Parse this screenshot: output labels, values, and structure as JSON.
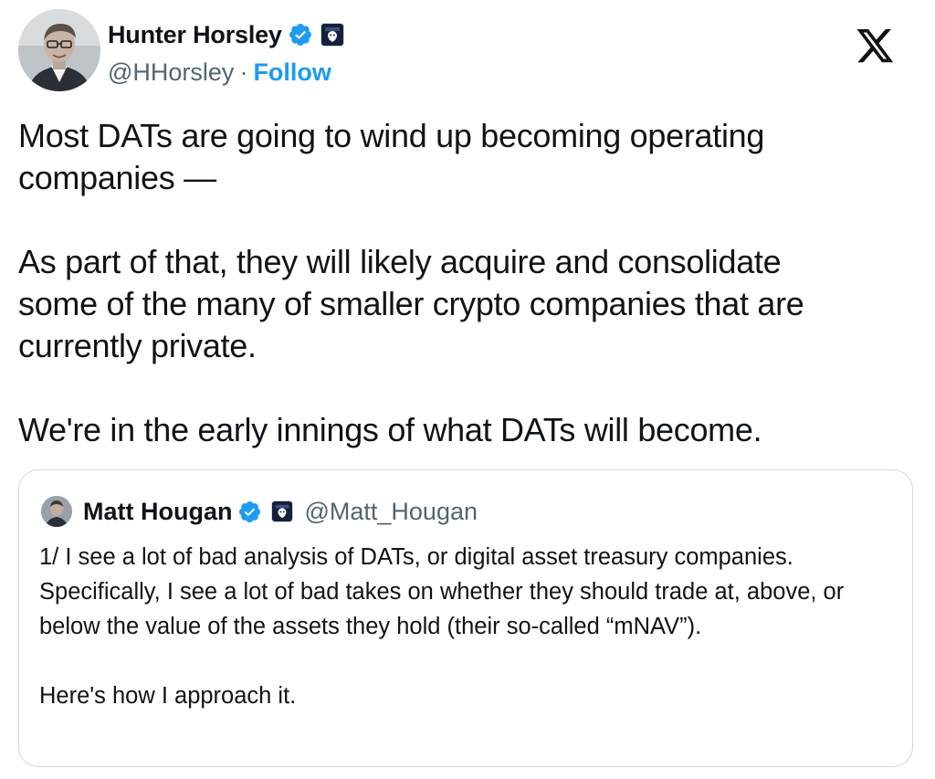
{
  "author": {
    "display_name": "Hunter Horsley",
    "handle": "@HHorsley",
    "separator": "·",
    "follow_label": "Follow",
    "avatar_icon": "person-avatar",
    "verified_icon": "verified-badge-icon",
    "affiliation_icon": "affiliate-badge-icon"
  },
  "tweet": {
    "paragraphs": [
      "Most DATs are going to wind up becoming operating\ncompanies —",
      "As part of that, they will likely acquire and consolidate\nsome of the many of smaller crypto companies that are\ncurrently private.",
      "We're in the early innings of what DATs will become."
    ]
  },
  "quoted": {
    "display_name": "Matt Hougan",
    "handle": "@Matt_Hougan",
    "paragraphs": [
      "1/ I see a lot of bad analysis of DATs, or digital asset treasury companies. Specifically, I see a lot of bad takes on whether they should trade at, above, or below the value of the assets they hold (their so-called “mNAV”).",
      "Here's how I approach it."
    ]
  },
  "colors": {
    "accent": "#1d9bf0",
    "text": "#0f1419",
    "muted": "#536471",
    "border": "#cfd9de"
  },
  "platform_icon": "x-logo-icon"
}
